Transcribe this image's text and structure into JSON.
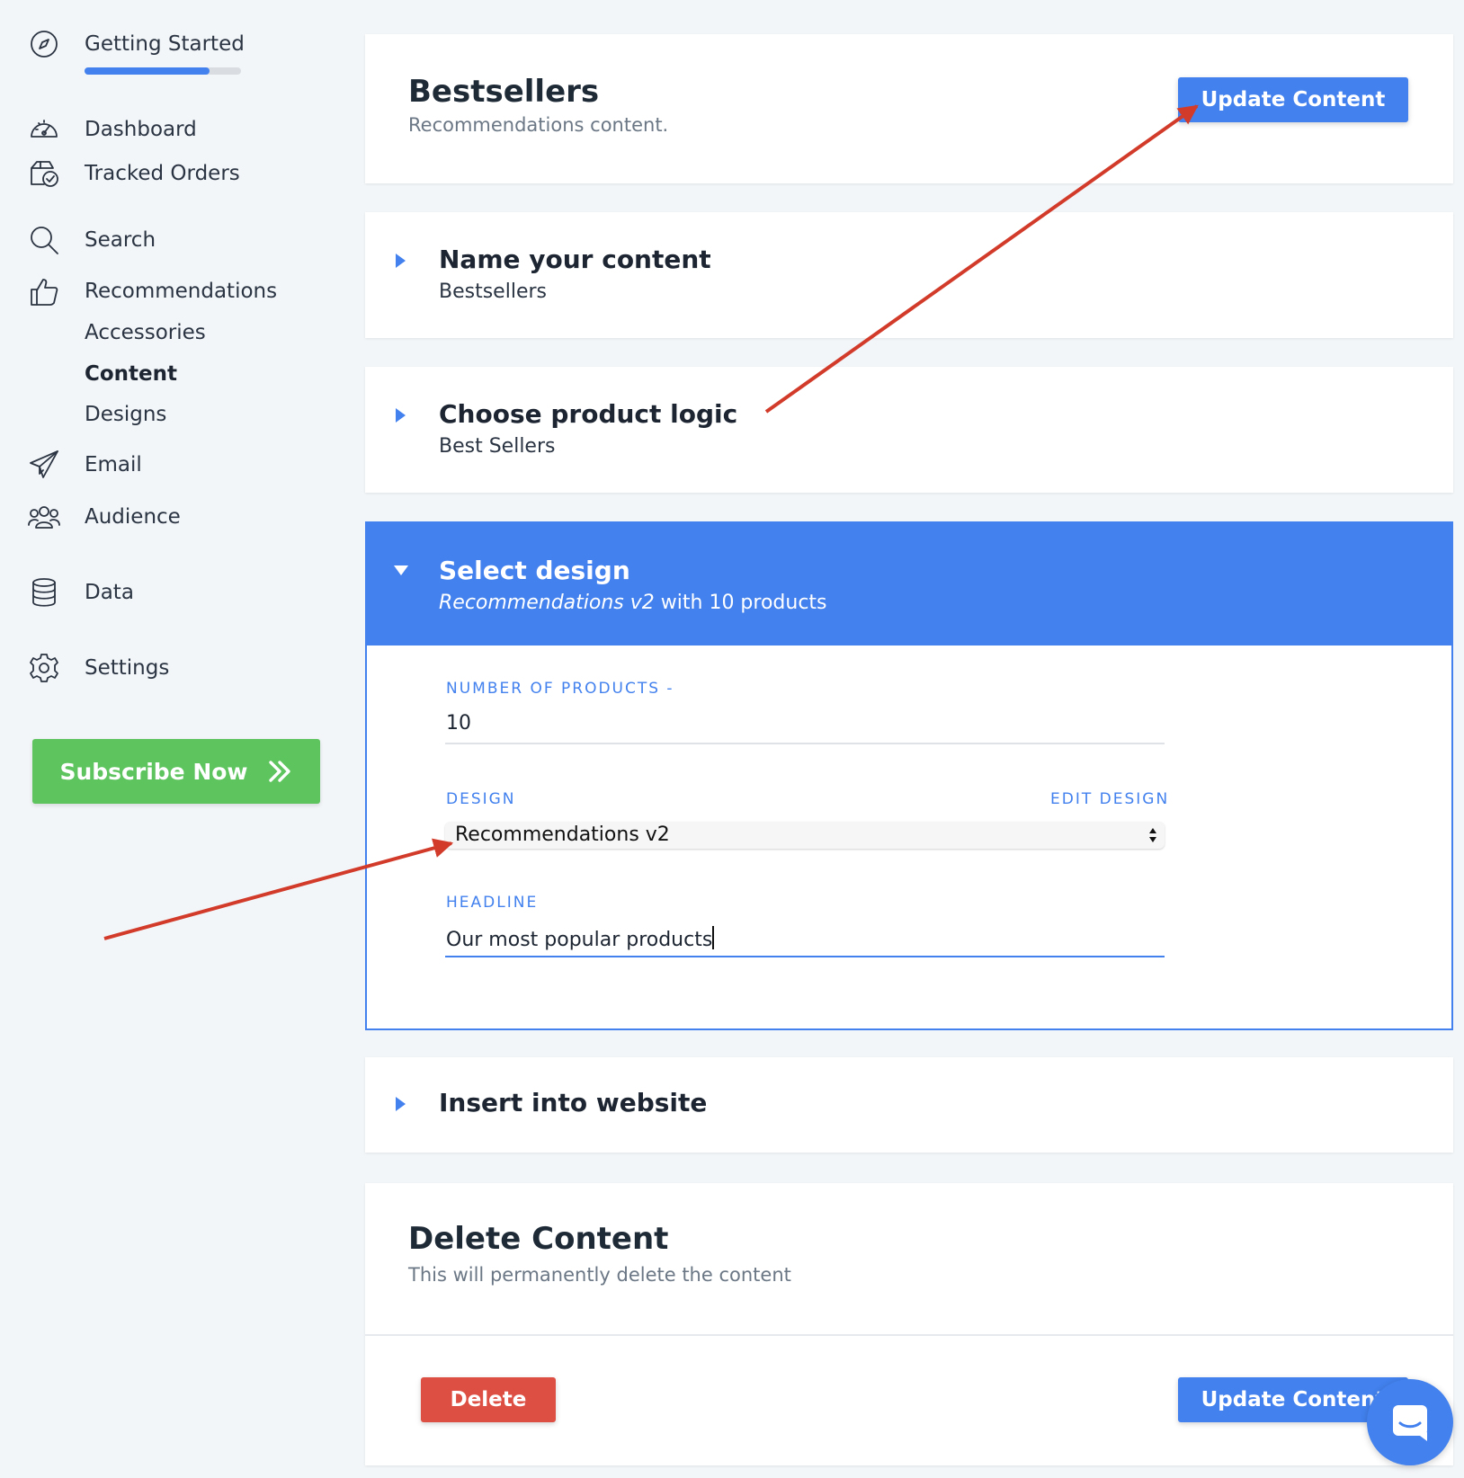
{
  "sidebar": {
    "getting_started": "Getting Started",
    "getting_started_progress": 0.8,
    "dashboard": "Dashboard",
    "tracked_orders": "Tracked Orders",
    "search": "Search",
    "recommendations": "Recommendations",
    "sub_items": [
      "Accessories",
      "Content",
      "Designs"
    ],
    "active_sub_item": "Content",
    "email": "Email",
    "audience": "Audience",
    "data": "Data",
    "settings": "Settings",
    "subscribe": "Subscribe Now"
  },
  "header": {
    "title": "Bestsellers",
    "subtitle": "Recommendations content.",
    "update_button": "Update Content"
  },
  "sections": {
    "name": {
      "title": "Name your content",
      "value": "Bestsellers"
    },
    "logic": {
      "title": "Choose product logic",
      "value": "Best Sellers"
    },
    "design": {
      "title": "Select design",
      "subtitle_italic": "Recommendations v2",
      "subtitle_rest": " with 10 products",
      "number_label": "NUMBER OF PRODUCTS -",
      "number_value": "10",
      "design_label": "DESIGN",
      "edit_design": "EDIT DESIGN",
      "design_value": "Recommendations v2",
      "headline_label": "HEADLINE",
      "headline_value": "Our most popular products"
    },
    "insert": {
      "title": "Insert into website"
    }
  },
  "delete": {
    "title": "Delete Content",
    "subtitle": "This will permanently delete the content",
    "delete_button": "Delete",
    "update_button": "Update Content"
  },
  "colors": {
    "accent": "#4281ee",
    "subscribe_green": "#5ec45e",
    "delete_red": "#de4f43",
    "annotation_red": "#d23b2a",
    "background": "#f3f6f9"
  },
  "icons": [
    "compass-icon",
    "dashboard-gauge-icon",
    "tracked-orders-icon",
    "search-icon",
    "thumbs-up-icon",
    "paper-plane-icon",
    "audience-icon",
    "database-icon",
    "gear-icon",
    "double-chevron-right-icon",
    "chat-icon"
  ]
}
